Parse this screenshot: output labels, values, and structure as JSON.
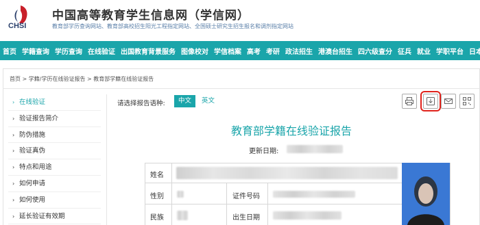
{
  "header": {
    "logo_text": "CHSI",
    "site_title": "中国高等教育学生信息网（学信网）",
    "site_subtitle": "教育部学历查询网站、教育部高校招生阳光工程指定网站、全国硕士研究生招生报名和调剂指定网站"
  },
  "nav": {
    "items": [
      "首页",
      "学籍查询",
      "学历查询",
      "在线验证",
      "出国教育背景服务",
      "图像校对",
      "学信档案",
      "高考",
      "考研",
      "政法招生",
      "港澳台招生",
      "四六级查分",
      "征兵",
      "就业",
      "学职平台",
      "日本频道"
    ]
  },
  "breadcrumb": "首页 > 学籍/学历在线验证报告 > 教育部学籍在线验证报告",
  "sidebar": {
    "items": [
      "在线验证",
      "验证报告简介",
      "防伪措施",
      "验证真伪",
      "特点和用途",
      "如何申请",
      "如何使用",
      "延长验证有效期"
    ]
  },
  "language": {
    "label": "请选择报告语种:",
    "chinese": "中文",
    "english": "英文"
  },
  "toolbar": {
    "icons": [
      "print-icon",
      "download-icon",
      "mail-icon",
      "qrcode-icon"
    ]
  },
  "report": {
    "title": "教育部学籍在线验证报告",
    "update_label": "更新日期:",
    "fields": {
      "name": "姓名",
      "gender": "性别",
      "id_type": "证件号码",
      "ethnicity": "民族",
      "birth_date": "出生日期"
    }
  },
  "colors": {
    "accent": "#1aa5aa",
    "highlight": "#e0211a"
  }
}
